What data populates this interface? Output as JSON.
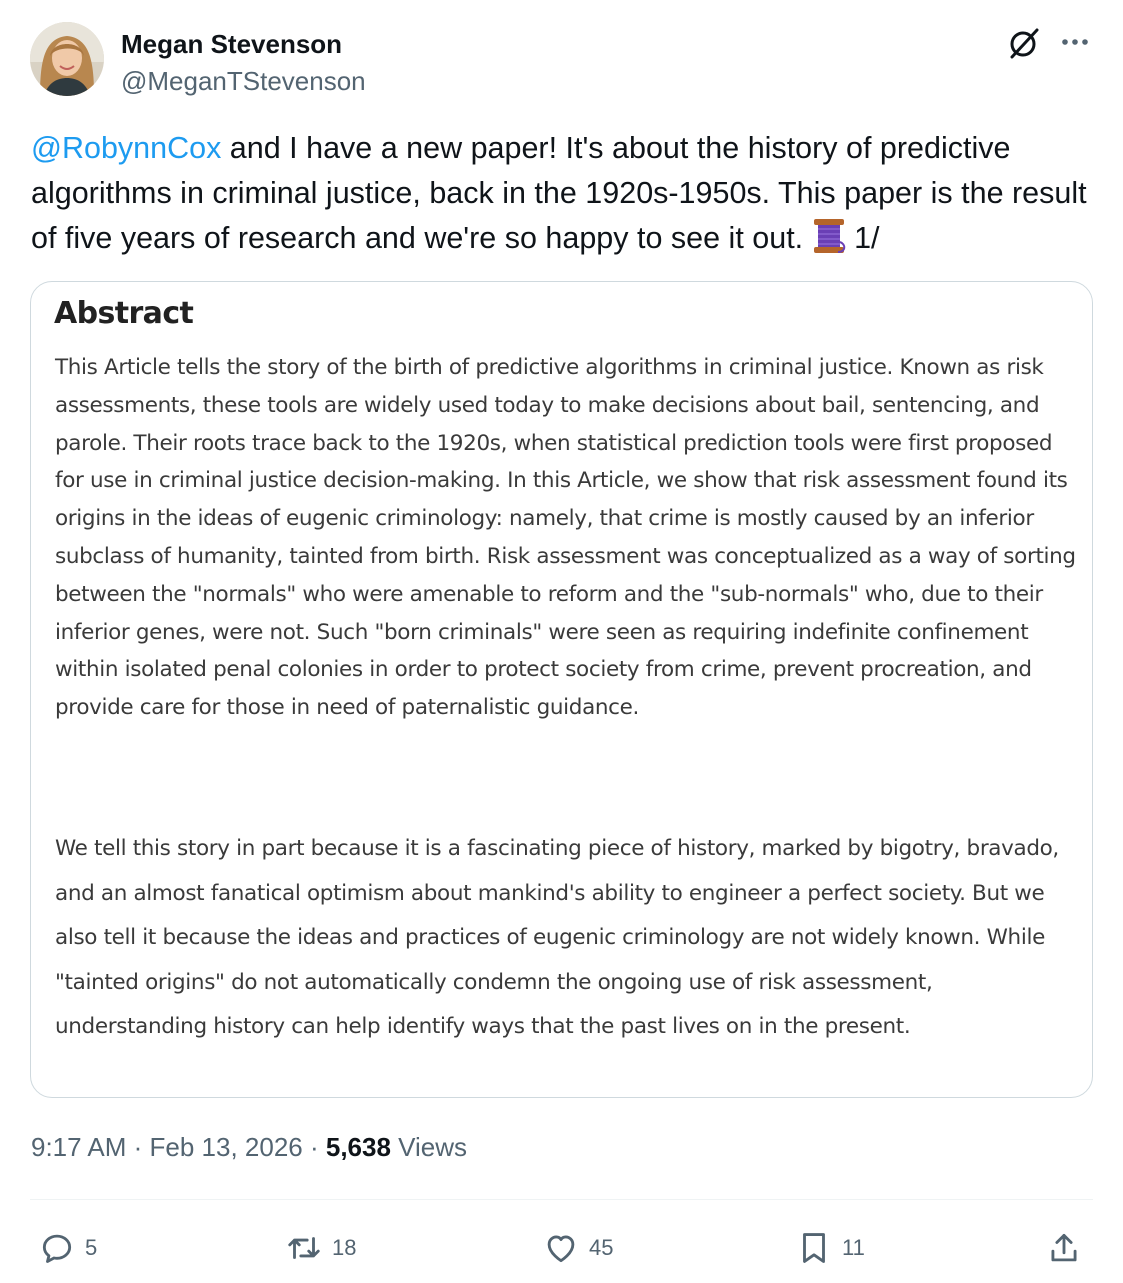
{
  "author": {
    "name": "Megan Stevenson",
    "handle": "@MeganTStevenson",
    "avatar_icon": "profile-photo"
  },
  "header_icons": [
    "grok-icon",
    "more-icon"
  ],
  "tweet": {
    "mention": "@RobynnCox",
    "text": " and I have a new paper! It's about the history of predictive algorithms in criminal justice, back in the 1920s-1950s. This paper is the result of five years of research and we're so happy to see it out. ",
    "thread_emoji": "thread-spool-icon",
    "suffix": " 1/"
  },
  "media": {
    "title": "Abstract",
    "paragraph1": "This Article tells the story of the birth of predictive algorithms in criminal justice. Known as risk assessments, these tools are widely used today to make decisions about bail, sentencing, and parole. Their roots trace back to the 1920s, when statistical prediction tools were first proposed for use in criminal justice decision-making. In this Article, we show that risk assessment found its origins in the ideas of eugenic criminology: namely, that crime is mostly caused by an inferior subclass of humanity, tainted from birth. Risk assessment was conceptualized as a way of sorting between the \"normals\" who were amenable to reform and the \"sub-normals\" who, due to their inferior genes, were not. Such \"born criminals\" were seen as requiring indefinite confinement within isolated penal colonies in order to protect society from crime, prevent procreation, and provide care for those in need of paternalistic guidance.",
    "paragraph2": "We tell this story in part because it is a fascinating piece of history, marked by bigotry, bravado, and an almost fanatical optimism about mankind's ability to engineer a perfect society. But we also tell it because the ideas and practices of eugenic criminology are not widely known. While \"tainted origins\" do not automatically condemn the ongoing use of risk assessment, understanding history can help identify ways that the past lives on in the present."
  },
  "meta": {
    "time": "9:17 AM",
    "separator1": " · ",
    "date": "Feb 13, 2026",
    "separator2": " · ",
    "views_count": "5,638",
    "views_label": " Views"
  },
  "actions": {
    "reply": {
      "icon": "reply-icon",
      "count": "5"
    },
    "retweet": {
      "icon": "retweet-icon",
      "count": "18"
    },
    "like": {
      "icon": "like-icon",
      "count": "45"
    },
    "bookmark": {
      "icon": "bookmark-icon",
      "count": "11"
    },
    "share": {
      "icon": "share-icon"
    }
  },
  "colors": {
    "text": "#0f1419",
    "secondary": "#536471",
    "link": "#1d9bf0",
    "border": "#cfd9de"
  }
}
